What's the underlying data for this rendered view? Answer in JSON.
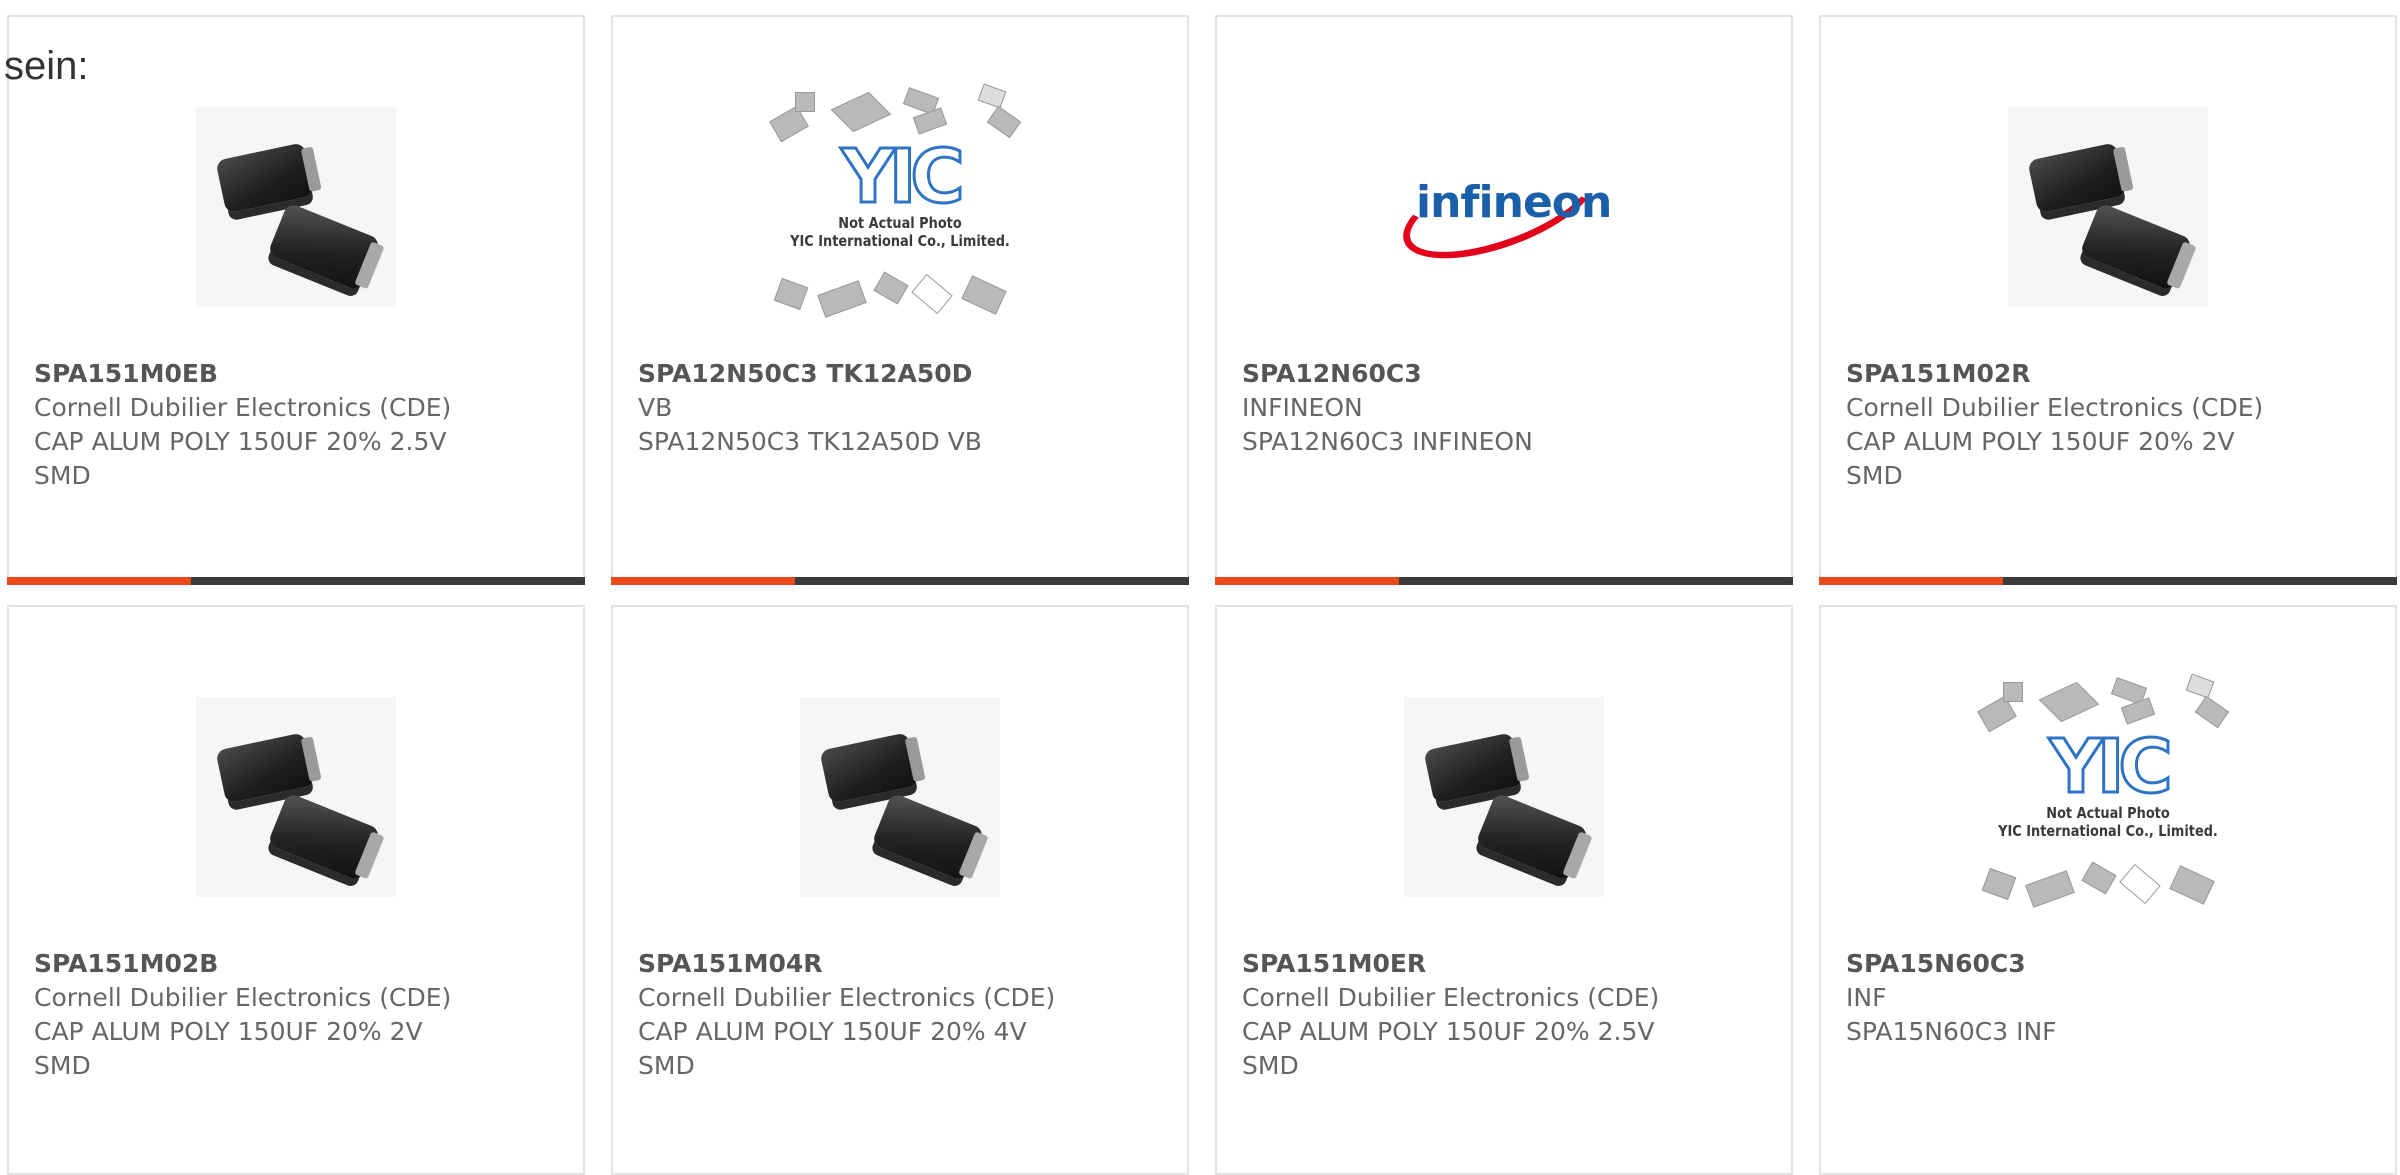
{
  "intro": {
    "text": "sein:"
  },
  "products": [
    {
      "part": "SPA151M0EB",
      "manufacturer": "Cornell Dubilier Electronics (CDE)",
      "description": "CAP ALUM POLY 150UF 20% 2.5V SMD",
      "image": "capacitor-photo"
    },
    {
      "part": "SPA12N50C3 TK12A50D",
      "manufacturer": "VB",
      "description": "SPA12N50C3 TK12A50D VB",
      "image": "not-actual-photo",
      "image_logo": "YIC",
      "image_caption": "Not Actual Photo\nYIC International Co., Limited."
    },
    {
      "part": "SPA12N60C3",
      "manufacturer": "INFINEON",
      "description": "SPA12N60C3 INFINEON",
      "image": "infineon-logo",
      "image_logo": "infineon"
    },
    {
      "part": "SPA151M02R",
      "manufacturer": "Cornell Dubilier Electronics (CDE)",
      "description": "CAP ALUM POLY 150UF 20% 2V SMD",
      "image": "capacitor-photo"
    },
    {
      "part": "SPA151M02B",
      "manufacturer": "Cornell Dubilier Electronics (CDE)",
      "description": "CAP ALUM POLY 150UF 20% 2V SMD",
      "image": "capacitor-photo"
    },
    {
      "part": "SPA151M04R",
      "manufacturer": "Cornell Dubilier Electronics (CDE)",
      "description": "CAP ALUM POLY 150UF 20% 4V SMD",
      "image": "capacitor-photo"
    },
    {
      "part": "SPA151M0ER",
      "manufacturer": "Cornell Dubilier Electronics (CDE)",
      "description": "CAP ALUM POLY 150UF 20% 2.5V SMD",
      "image": "capacitor-photo"
    },
    {
      "part": "SPA15N60C3",
      "manufacturer": "INF",
      "description": "SPA15N60C3 INF",
      "image": "not-actual-photo",
      "image_logo": "YIC",
      "image_caption": "Not Actual Photo\nYIC International Co., Limited."
    }
  ],
  "colors": {
    "accent": "#e84a1a",
    "bar": "#3a3a3a",
    "border": "#e3e3e3",
    "text": "#666666",
    "infineon_red": "#e2001a",
    "infineon_blue": "#1a5fa8",
    "yic_blue": "#2f73c4"
  }
}
